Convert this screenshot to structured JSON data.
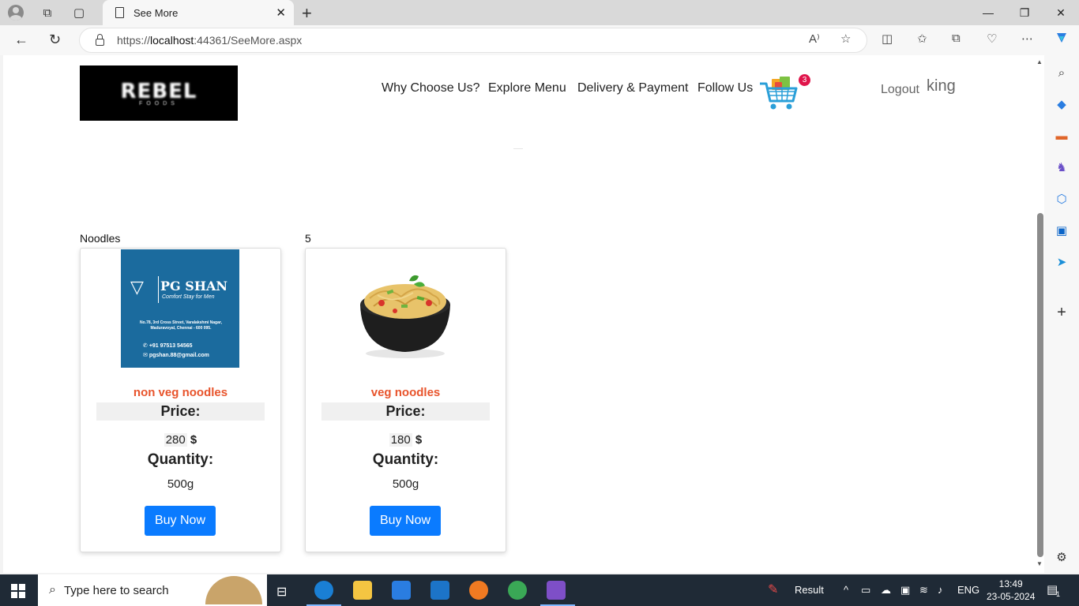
{
  "browser": {
    "tab_title": "See More",
    "url_host": "localhost",
    "url_prefix": "https://",
    "url_suffix": ":44361/SeeMore.aspx"
  },
  "header": {
    "logo_text": "REBEL",
    "logo_sub": "FOODS",
    "menu": [
      "Why Choose Us?",
      "Explore Menu",
      "Delivery & Payment",
      "Follow Us"
    ],
    "cart_count": "3",
    "logout_label": "Logout",
    "username": "king"
  },
  "listing": {
    "category": "Noodles",
    "count": "5"
  },
  "products": [
    {
      "name": "non veg noodles",
      "price_label": "Price:",
      "price": "280",
      "currency": "$",
      "qty_label": "Quantity:",
      "qty": "500g",
      "buy_label": "Buy Now",
      "image": {
        "brand": "PG SHAN",
        "tagline": "Comfort Stay for Men",
        "address": "No.78, 3rd Cross Street, Varalakshmi Nagar, Maduravoyal, Chennai - 600 095.",
        "phone": "+91 97513 54565",
        "email": "pgshan.88@gmail.com"
      }
    },
    {
      "name": "veg noodles",
      "price_label": "Price:",
      "price": "180",
      "currency": "$",
      "qty_label": "Quantity:",
      "qty": "500g",
      "buy_label": "Buy Now"
    }
  ],
  "taskbar": {
    "search_placeholder": "Type here to search",
    "result_label": "Result",
    "lang": "ENG",
    "time": "13:49",
    "date": "23-05-2024",
    "notif_count": "1"
  },
  "colors": {
    "accent_blue": "#0a7bff",
    "product_name": "#e8542c",
    "badge_red": "#e0154b"
  }
}
